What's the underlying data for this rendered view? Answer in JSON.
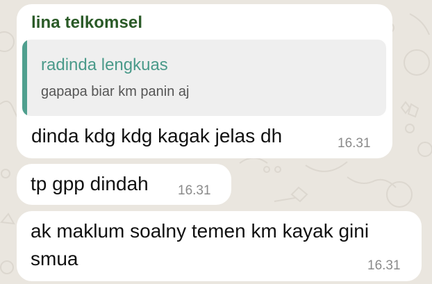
{
  "messages": [
    {
      "sender": "lina telkomsel",
      "quote": {
        "author": "radinda lengkuas",
        "text": "gapapa biar km panin aj"
      },
      "text": "dinda kdg kdg kagak jelas dh",
      "time": "16.31"
    },
    {
      "text": "tp gpp dindah",
      "time": "16.31"
    },
    {
      "text": "ak maklum soalny temen km kayak gini smua",
      "time": "16.31"
    }
  ],
  "colors": {
    "chat_background": "#eae6df",
    "bubble_background": "#ffffff",
    "sender_name": "#2a5a27",
    "quote_accent": "#4f9f8e",
    "quote_background": "#efefef",
    "timestamp": "#8a8a8a"
  }
}
